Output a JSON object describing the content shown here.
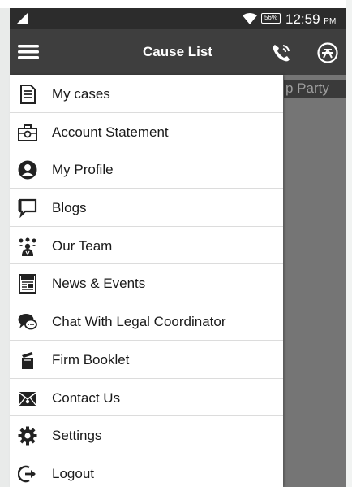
{
  "status_bar": {
    "battery": "56%",
    "time": "12:59",
    "ampm": "PM"
  },
  "app_bar": {
    "title": "Cause List"
  },
  "background": {
    "party_text": "p Party"
  },
  "drawer": {
    "items": [
      {
        "label": "My cases",
        "icon": "document-icon"
      },
      {
        "label": "Account Statement",
        "icon": "briefcase-icon"
      },
      {
        "label": "My Profile",
        "icon": "person-icon"
      },
      {
        "label": "Blogs",
        "icon": "chat-bubble-icon"
      },
      {
        "label": "Our Team",
        "icon": "team-icon"
      },
      {
        "label": "News & Events",
        "icon": "newspaper-icon"
      },
      {
        "label": "Chat With Legal Coordinator",
        "icon": "chat-icon"
      },
      {
        "label": "Firm Booklet",
        "icon": "booklet-icon"
      },
      {
        "label": "Contact Us",
        "icon": "envelope-icon"
      },
      {
        "label": "Settings",
        "icon": "gear-icon"
      },
      {
        "label": "Logout",
        "icon": "logout-icon"
      }
    ]
  },
  "colors": {
    "status_bar": "#2c2c2c",
    "app_bar": "#3e3e3e",
    "content_dim": "#757575",
    "drawer_bg": "#ffffff",
    "text": "#1a1a1a"
  }
}
